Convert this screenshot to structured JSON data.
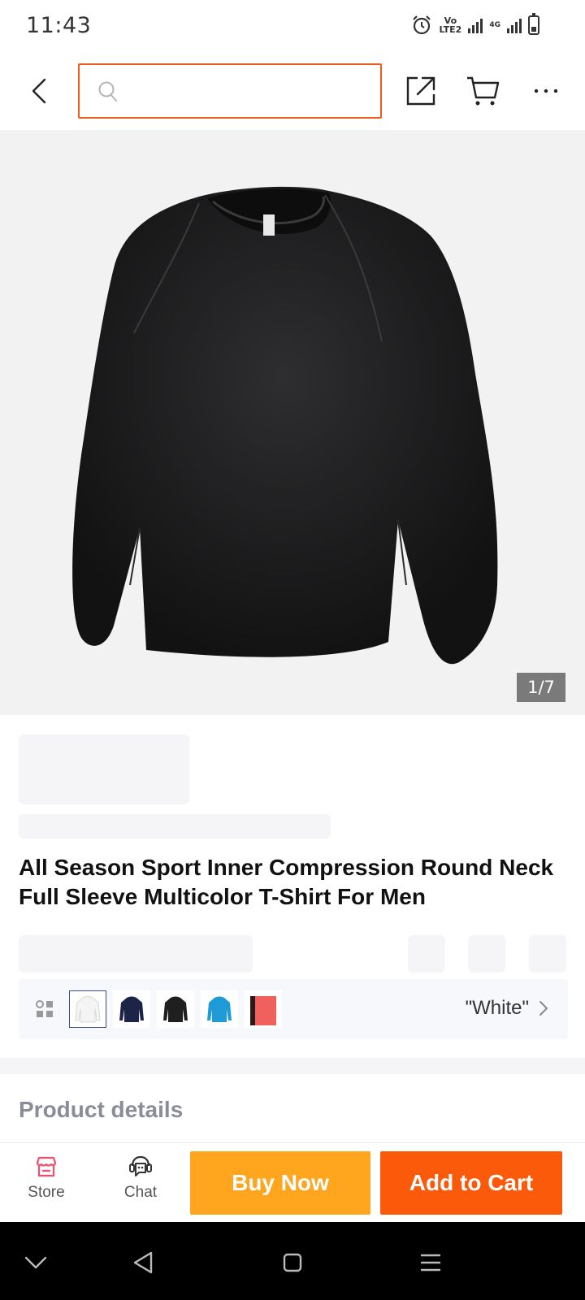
{
  "status_bar": {
    "time": "11:43",
    "volte_label_top": "Vo",
    "volte_label_bottom": "LTE2",
    "network_label": "4G"
  },
  "header": {
    "search_placeholder": "",
    "icons": [
      "back-icon",
      "search-icon",
      "share-icon",
      "cart-icon",
      "more-icon"
    ],
    "accent_color": "#f05a1a"
  },
  "gallery": {
    "page_indicator": "1/7",
    "image_subject": "black long sleeve compression t-shirt"
  },
  "product": {
    "title": "All Season Sport Inner Compression Round Neck Full Sleeve Multicolor T-Shirt For Men"
  },
  "variants": {
    "selected_value": "\"White\"",
    "swatch_colors": [
      "#ffffff",
      "#1c2447",
      "#1f1f1f",
      "#1e9ad6",
      "#f0605c"
    ],
    "selected_index": 0
  },
  "details": {
    "heading": "Product details"
  },
  "action_bar": {
    "store_label": "Store",
    "chat_label": "Chat",
    "buy_now_label": "Buy Now",
    "add_to_cart_label": "Add to Cart",
    "buy_now_color": "#ffa51e",
    "add_to_cart_color": "#fb5a0a",
    "store_icon_color": "#f0506e"
  }
}
